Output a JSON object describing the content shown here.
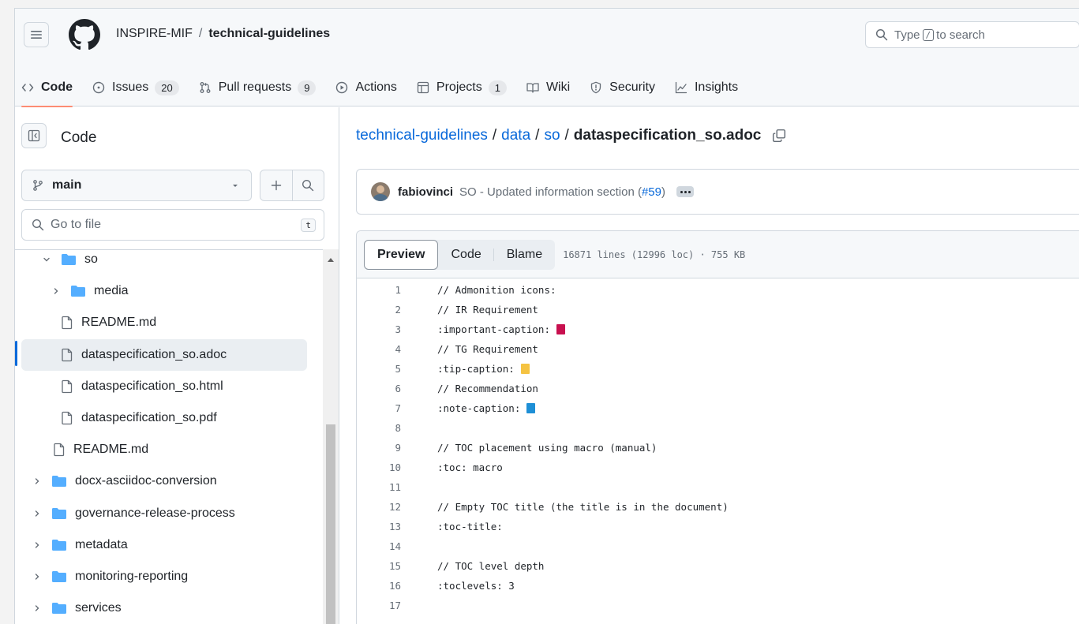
{
  "header": {
    "owner": "INSPIRE-MIF",
    "separator": "/",
    "repo": "technical-guidelines",
    "search_prefix": "Type",
    "search_key": "/",
    "search_suffix": "to search"
  },
  "tabs": [
    {
      "label": "Code",
      "icon": "code-icon",
      "count": null,
      "active": true
    },
    {
      "label": "Issues",
      "icon": "issue-opened-icon",
      "count": "20"
    },
    {
      "label": "Pull requests",
      "icon": "git-pull-request-icon",
      "count": "9"
    },
    {
      "label": "Actions",
      "icon": "play-icon",
      "count": null
    },
    {
      "label": "Projects",
      "icon": "table-icon",
      "count": "1"
    },
    {
      "label": "Wiki",
      "icon": "book-icon",
      "count": null
    },
    {
      "label": "Security",
      "icon": "shield-icon",
      "count": null
    },
    {
      "label": "Insights",
      "icon": "graph-icon",
      "count": null
    }
  ],
  "sidebar": {
    "title": "Code",
    "branch": "main",
    "goto_placeholder": "Go to file",
    "goto_shortcut": "t",
    "items": [
      {
        "label": "so",
        "type": "folder",
        "expanded": true,
        "depth": 1
      },
      {
        "label": "media",
        "type": "folder",
        "expanded": false,
        "depth": 2
      },
      {
        "label": "README.md",
        "type": "file",
        "depth": 2
      },
      {
        "label": "dataspecification_so.adoc",
        "type": "file",
        "depth": 2,
        "selected": true
      },
      {
        "label": "dataspecification_so.html",
        "type": "file",
        "depth": 2
      },
      {
        "label": "dataspecification_so.pdf",
        "type": "file",
        "depth": 2
      },
      {
        "label": "README.md",
        "type": "file",
        "depth": 1
      },
      {
        "label": "docx-asciidoc-conversion",
        "type": "folder",
        "expanded": false,
        "depth": 0
      },
      {
        "label": "governance-release-process",
        "type": "folder",
        "expanded": false,
        "depth": 0
      },
      {
        "label": "metadata",
        "type": "folder",
        "expanded": false,
        "depth": 0
      },
      {
        "label": "monitoring-reporting",
        "type": "folder",
        "expanded": false,
        "depth": 0
      },
      {
        "label": "services",
        "type": "folder",
        "expanded": false,
        "depth": 0
      }
    ]
  },
  "breadcrumb": {
    "parts": [
      "technical-guidelines",
      "data",
      "so"
    ],
    "separator": "/",
    "file": "dataspecification_so.adoc"
  },
  "commit": {
    "author": "fabiovinci",
    "message": "SO - Updated information section (",
    "pr": "#59",
    "message_end": ")"
  },
  "file_view": {
    "modes": [
      "Preview",
      "Code",
      "Blame"
    ],
    "active_mode": "Preview",
    "meta": "16871 lines (12996 loc) · 755 KB"
  },
  "code_lines": [
    {
      "n": "1",
      "text": "// Admonition icons:"
    },
    {
      "n": "2",
      "text": "// IR Requirement"
    },
    {
      "n": "3",
      "text": ":important-caption:",
      "swatch": "#c8104f"
    },
    {
      "n": "4",
      "text": "// TG Requirement"
    },
    {
      "n": "5",
      "text": ":tip-caption:",
      "swatch": "#f5c342"
    },
    {
      "n": "6",
      "text": "// Recommendation"
    },
    {
      "n": "7",
      "text": ":note-caption:",
      "swatch": "#1e8fd6"
    },
    {
      "n": "8",
      "text": ""
    },
    {
      "n": "9",
      "text": "// TOC placement using macro (manual)"
    },
    {
      "n": "10",
      "text": ":toc: macro"
    },
    {
      "n": "11",
      "text": ""
    },
    {
      "n": "12",
      "text": "// Empty TOC title (the title is in the document)"
    },
    {
      "n": "13",
      "text": ":toc-title:"
    },
    {
      "n": "14",
      "text": ""
    },
    {
      "n": "15",
      "text": "// TOC level depth"
    },
    {
      "n": "16",
      "text": ":toclevels: 3"
    },
    {
      "n": "17",
      "text": ""
    }
  ],
  "colors": {
    "link": "#0969da",
    "folder": "#54aeff",
    "active_tab_underline": "#fd8c73"
  }
}
